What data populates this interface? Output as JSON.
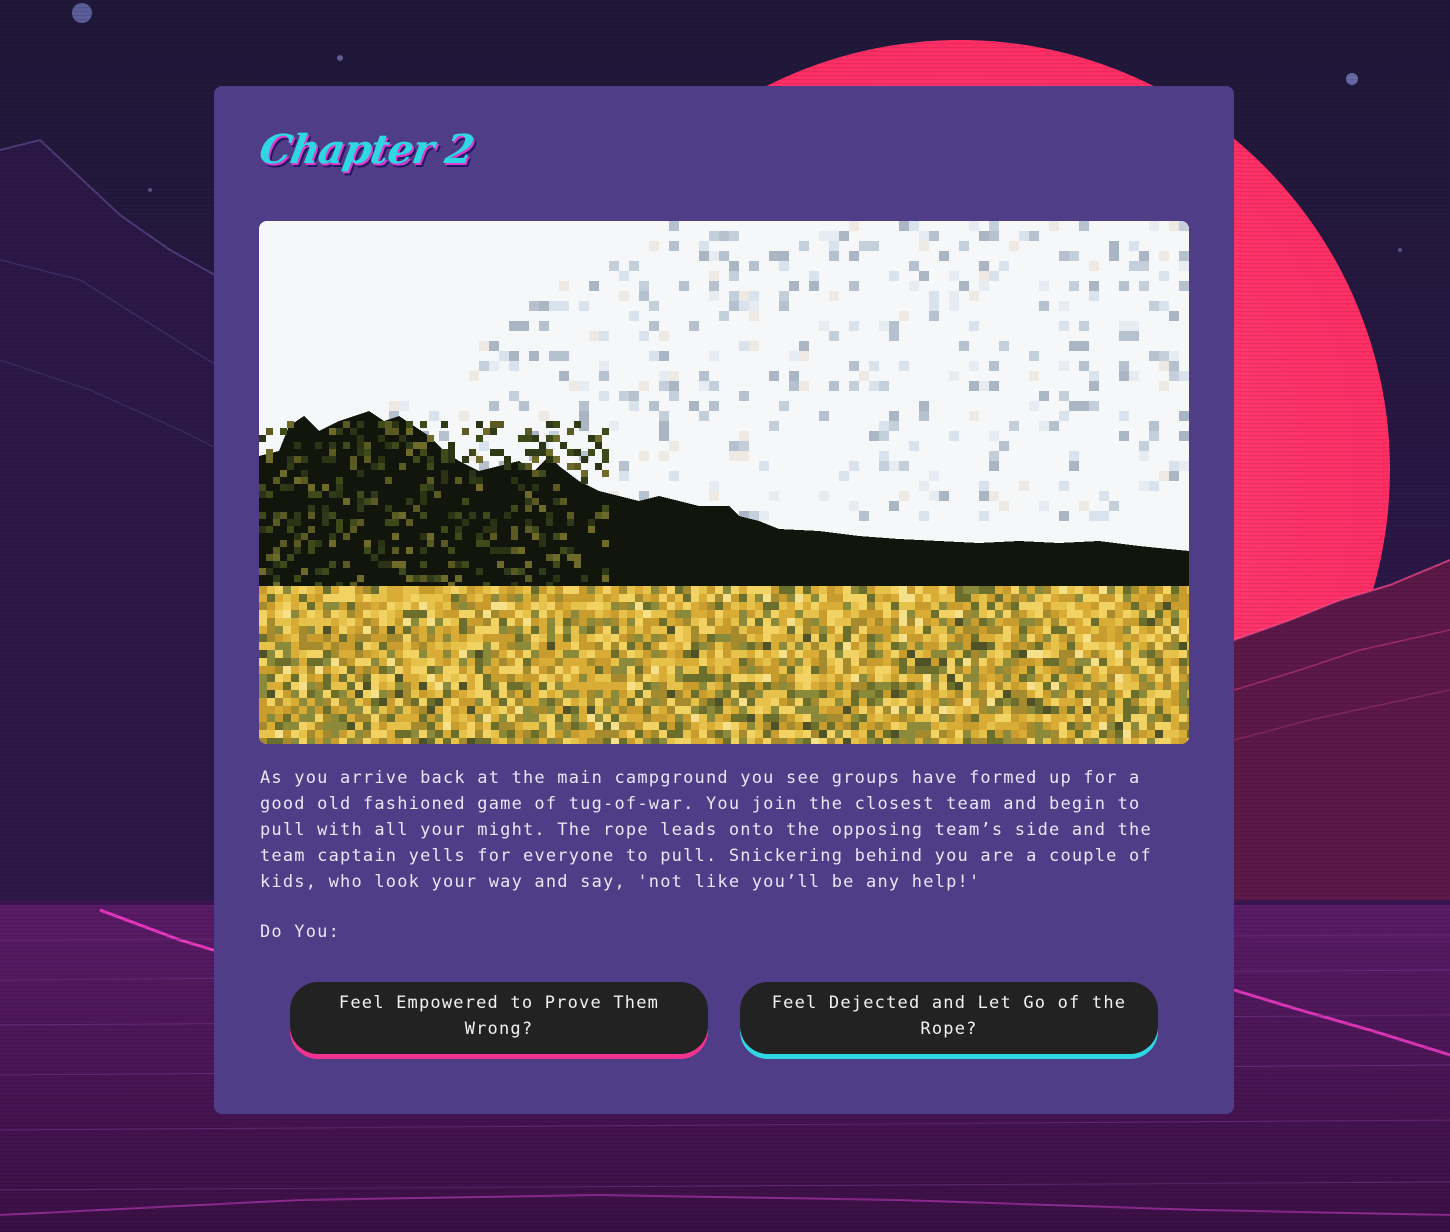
{
  "chapter": {
    "title": "Chapter 2"
  },
  "story": {
    "text": "As you arrive back at the main campground you see groups have formed up for a good old fashioned game of tug-of-war. You join the closest team and begin to pull with all your might. The rope leads onto the opposing team’s side and the team captain yells for everyone to pull. Snickering behind you are a couple of kids, who look your way and say, 'not like you’ll be any help!'",
    "prompt": "Do You:"
  },
  "choices": [
    {
      "label": "Feel Empowered to Prove Them Wrong?",
      "accent": "#f0338f"
    },
    {
      "label": "Feel Dejected and Let Go of the Rope?",
      "accent": "#2fd7e3"
    }
  ],
  "theme": {
    "card": "#4f3d87",
    "title_color": "#2fd7e3",
    "title_shadow": "#d93ecf",
    "sun": "#ff3d6e",
    "button": "#222222"
  },
  "scene_image": {
    "icon": "pixel-art-meadow-forest-image"
  }
}
